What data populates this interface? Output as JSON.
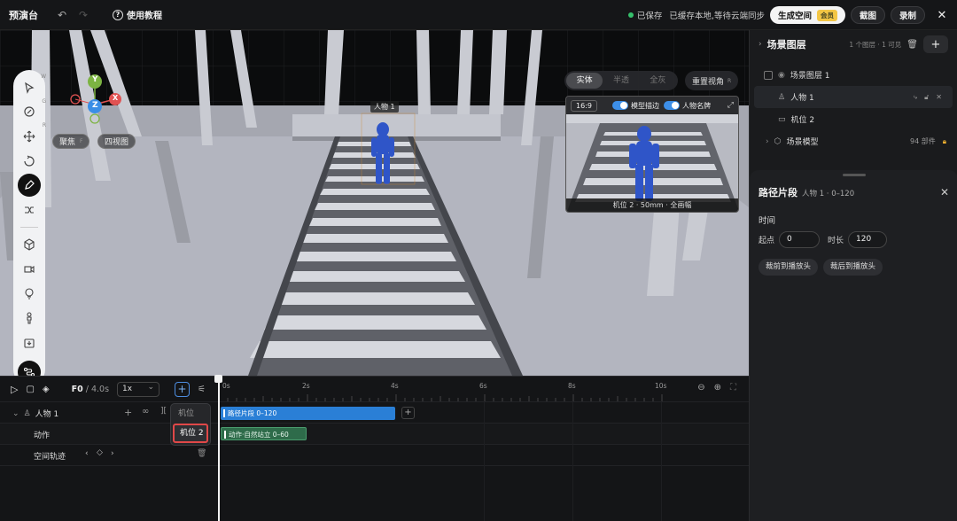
{
  "app": {
    "title": "预演台",
    "tutorial": "使用教程"
  },
  "status": {
    "saved": "已保存",
    "sync": "已缓存本地,等待云端同步"
  },
  "header_buttons": {
    "generate": "生成空间",
    "vip": "会员",
    "screenshot": "截图",
    "record": "录制"
  },
  "viewport": {
    "focus_label": "聚焦",
    "focus_key": "F",
    "four_view_label": "四视图",
    "modes": [
      "实体",
      "半透",
      "全灰"
    ],
    "active_mode": "实体",
    "reset_view": "重置视角",
    "reset_key": "R",
    "axis": {
      "y": "Y",
      "z": "Z",
      "x": "X"
    },
    "character_label": "人物 1",
    "tool_keys": [
      "W",
      "G",
      "R"
    ]
  },
  "preview": {
    "ratio": "16:9",
    "toggle_outline": "模型描边",
    "toggle_nameplate": "人物名牌",
    "footer": "机位 2 · 50mm · 全画幅"
  },
  "layers": {
    "title": "场景图层",
    "meta": "1 个图层 · 1 可见",
    "items": [
      {
        "label": "场景图层 1"
      },
      {
        "label": "人物 1"
      },
      {
        "label": "机位 2"
      },
      {
        "label": "场景模型",
        "badge": "94 部件"
      }
    ]
  },
  "segment": {
    "title": "路径片段",
    "subtitle": "人物 1 · 0–120",
    "section": "时间",
    "start_label": "起点",
    "start_value": "0",
    "duration_label": "时长",
    "duration_value": "120",
    "trim_front": "裁前到播放头",
    "trim_back": "裁后到播放头"
  },
  "timeline": {
    "frame": "F0",
    "total": "/ 4.0s",
    "speed": "1x",
    "ruler": [
      "0s",
      "2s",
      "4s",
      "6s",
      "8s",
      "10s"
    ],
    "track_name": "人物 1",
    "sub_action": "动作",
    "sub_path": "空间轨迹",
    "clip_path": "路径片段 0–120",
    "clip_action": "动作·自然站立 0–60",
    "dropdown": [
      "机位",
      "机位 2"
    ]
  }
}
